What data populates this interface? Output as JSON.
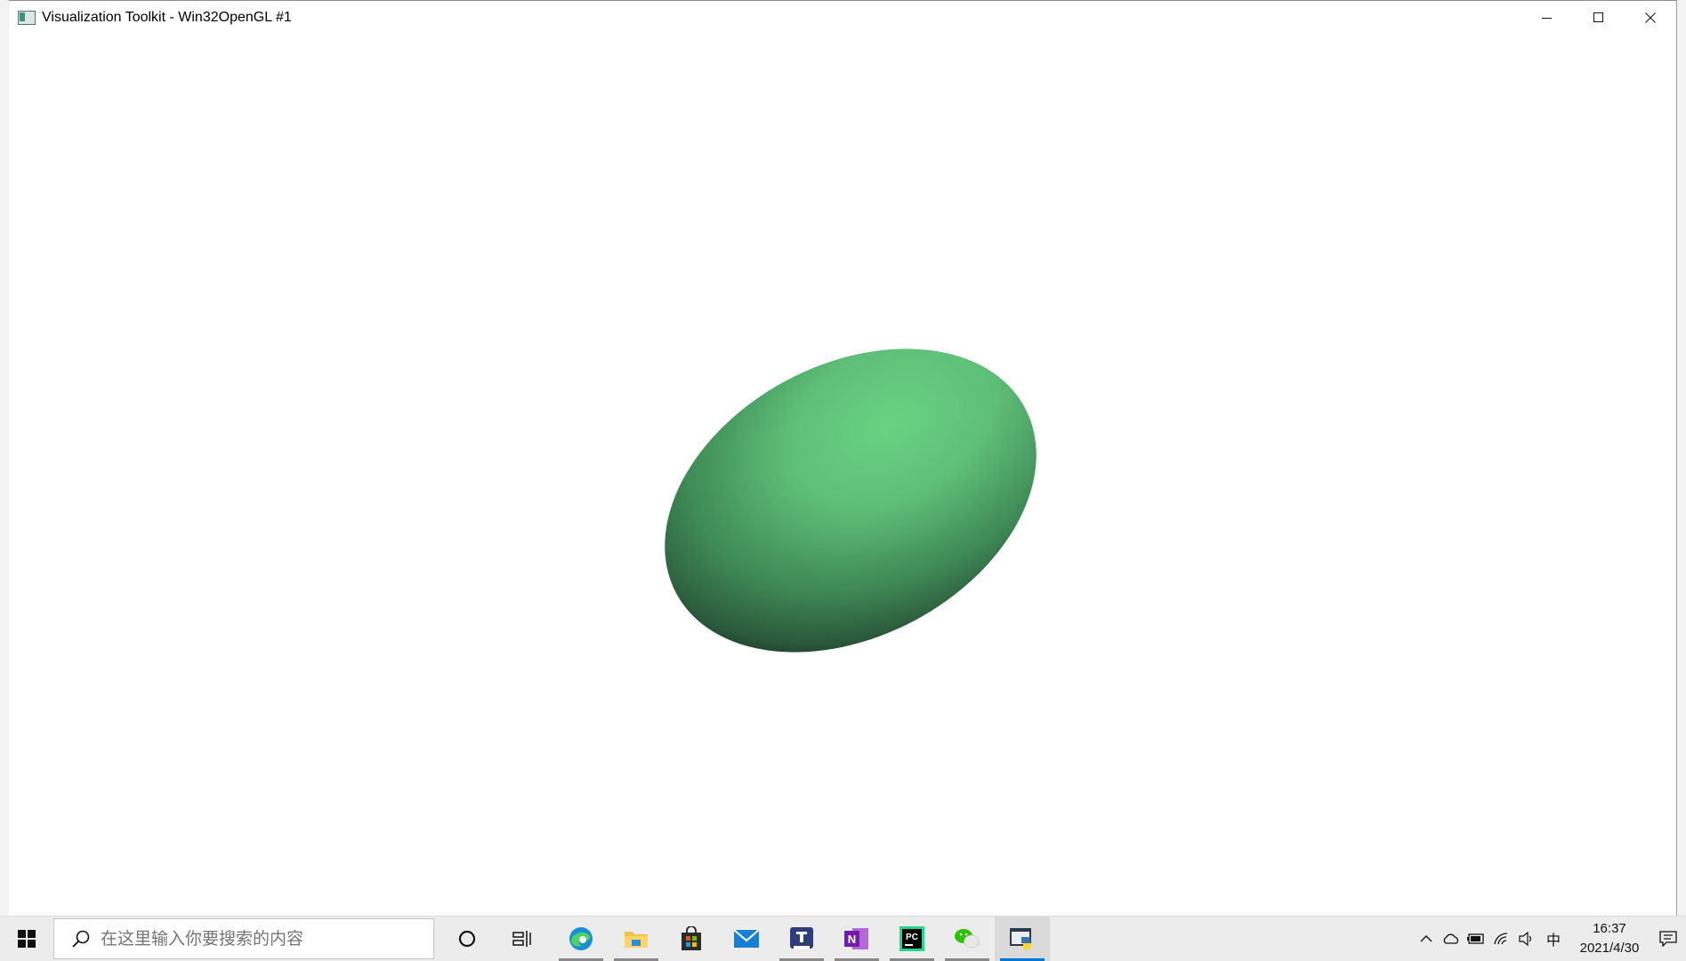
{
  "window": {
    "title": "Visualization Toolkit - Win32OpenGL #1",
    "controls": {
      "minimize": "minimize-icon",
      "maximize": "maximize-icon",
      "close": "close-icon"
    }
  },
  "scene": {
    "object": "ellipsoid",
    "base_color": "#5fbf7a",
    "highlight_color": "#67d381",
    "shadow_color": "#2c5c3b",
    "background": "#ffffff"
  },
  "taskbar": {
    "search": {
      "placeholder": "在这里输入你要搜索的内容"
    },
    "pinned": [
      {
        "name": "cortana",
        "icon": "cortana-ring-icon"
      },
      {
        "name": "task-view",
        "icon": "task-view-icon"
      },
      {
        "name": "edge",
        "icon": "edge-icon"
      },
      {
        "name": "file-explorer",
        "icon": "folder-icon"
      },
      {
        "name": "store",
        "icon": "store-bag-icon"
      },
      {
        "name": "mail",
        "icon": "mail-icon"
      },
      {
        "name": "typora",
        "icon": "typora-icon"
      },
      {
        "name": "onenote",
        "icon": "onenote-icon",
        "letter": "N"
      },
      {
        "name": "pycharm",
        "icon": "pycharm-icon",
        "letter": "PC"
      },
      {
        "name": "wechat",
        "icon": "wechat-icon"
      },
      {
        "name": "python-vtk",
        "icon": "python-icon"
      }
    ],
    "tray": {
      "ime": "中",
      "time": "16:37",
      "date": "2021/4/30"
    }
  }
}
